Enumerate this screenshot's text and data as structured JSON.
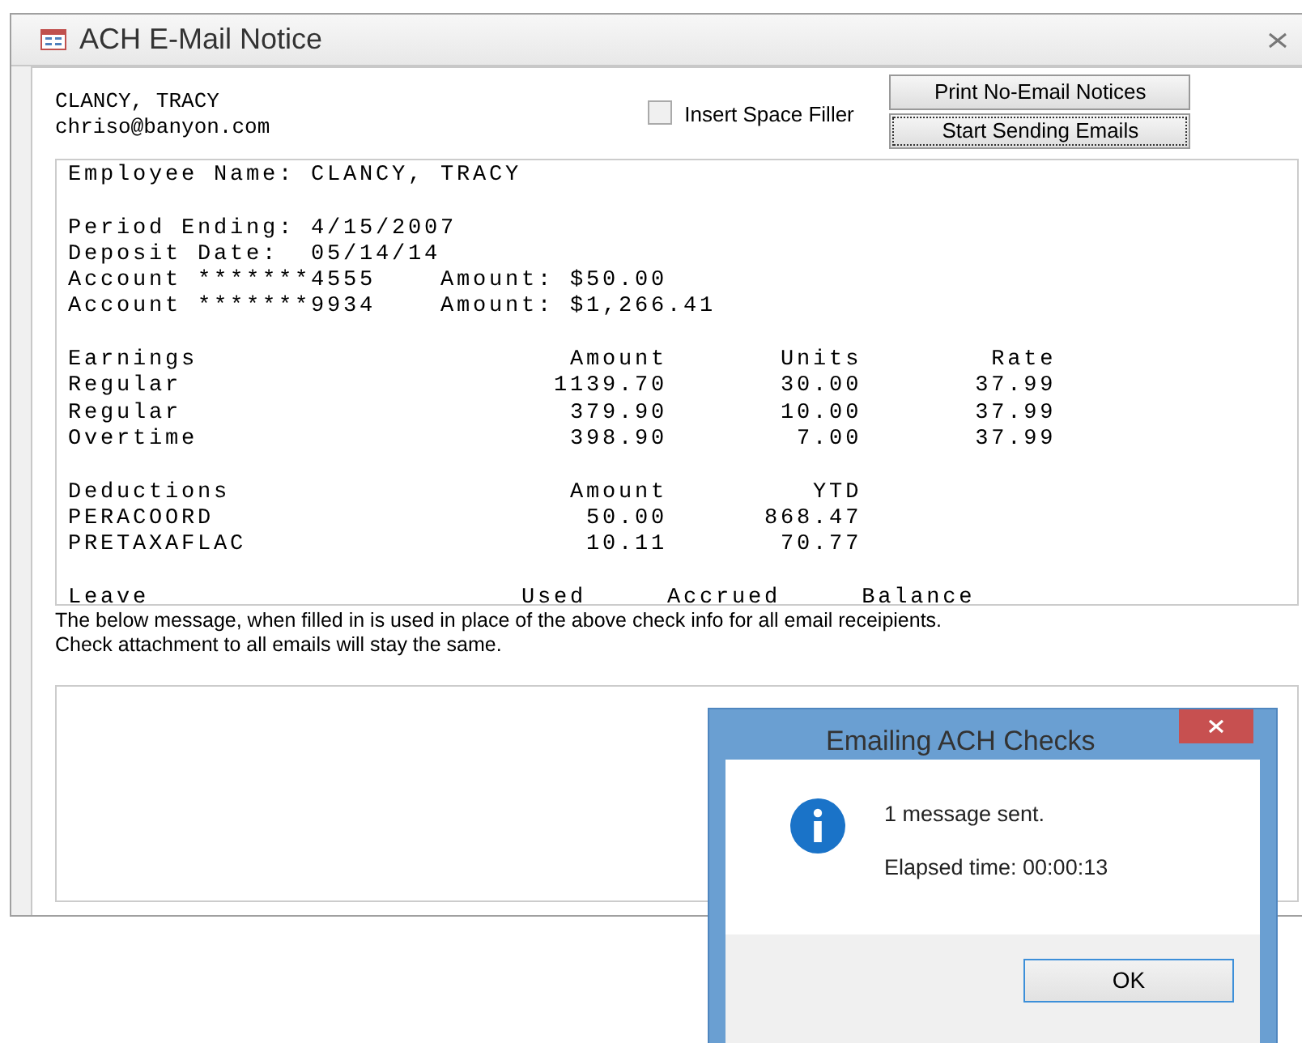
{
  "window": {
    "title": "ACH E-Mail Notice"
  },
  "recipient": {
    "name": "CLANCY, TRACY",
    "email": "chriso@banyon.com"
  },
  "space_filler": {
    "label": "Insert Space Filler",
    "checked": false
  },
  "buttons": [
    {
      "label": "Print No-Email Notices",
      "focused": false
    },
    {
      "label": "Start Sending Emails",
      "focused": true
    }
  ],
  "notice_blocks": [
    [
      "Employee Name: CLANCY, TRACY"
    ],
    [
      "Period Ending: 4/15/2007",
      "Deposit Date:  05/14/14",
      "Account *******4555    Amount: $50.00",
      "Account *******9934    Amount: $1,266.41"
    ],
    [
      "Earnings                       Amount       Units        Rate",
      "Regular                       1139.70       30.00       37.99",
      "Regular                        379.90       10.00       37.99",
      "Overtime                       398.90        7.00       37.99"
    ],
    [
      "Deductions                     Amount         YTD",
      "PERACOORD                       50.00      868.47",
      "PRETAXAFLAC                     10.11       70.77"
    ],
    [
      "Leave                       Used     Accrued     Balance"
    ]
  ],
  "message_hint": [
    "The below message, when filled in is used in place of the above check info for all email receipients.",
    "Check attachment to all emails will stay the same."
  ],
  "dialog": {
    "title": "Emailing ACH Checks",
    "lines": [
      "1 message sent.",
      "Elapsed time: 00:00:13"
    ],
    "button": "OK"
  }
}
